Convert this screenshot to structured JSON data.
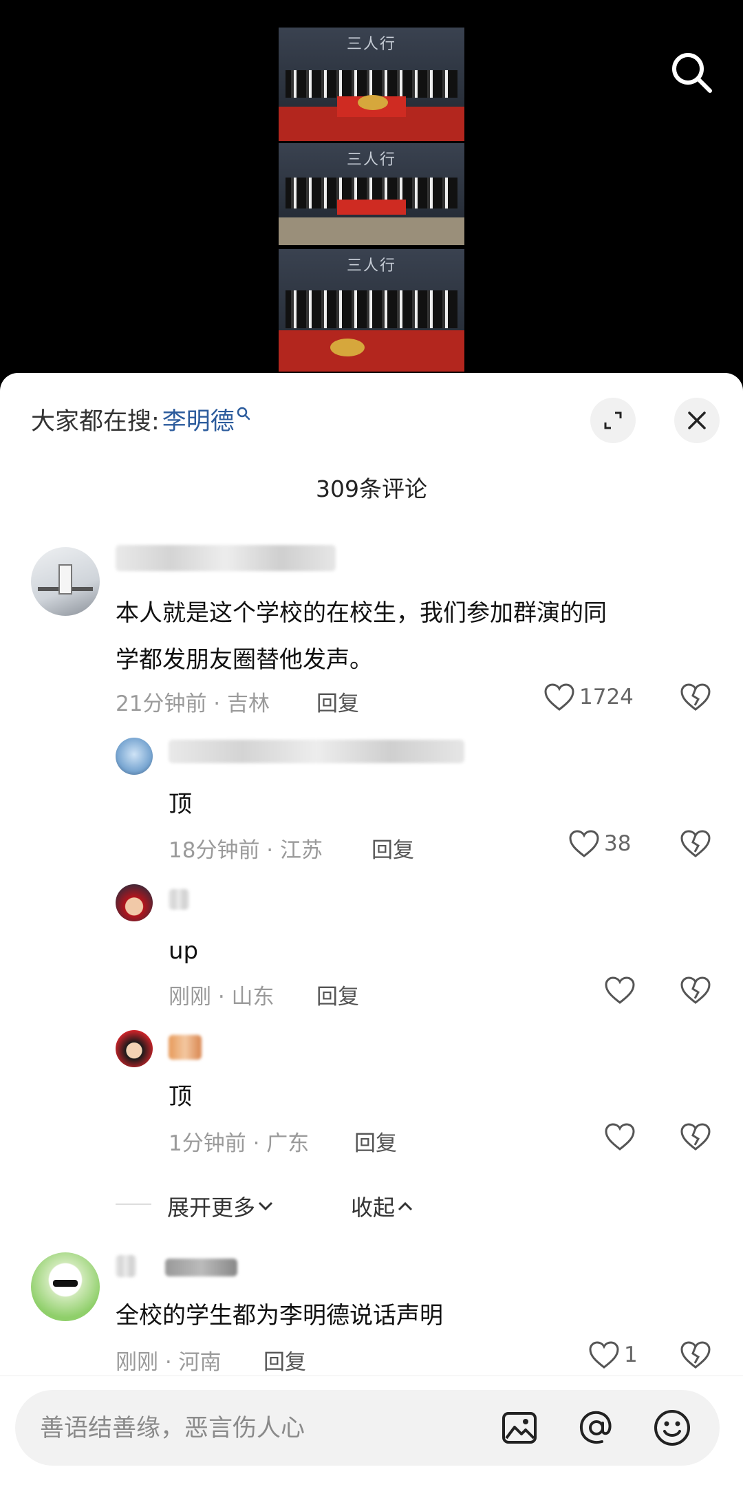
{
  "video": {
    "photo_logo": "三人行"
  },
  "search_bar": {
    "prefix": "大家都在搜:",
    "keyword": "李明德"
  },
  "comment_count": "309条评论",
  "comments": [
    {
      "text_line1": "本人就是这个学校的在校生，我们参加群演的同",
      "text_line2": "学都发朋友圈替他发声。",
      "meta": "21分钟前 · 吉林",
      "reply": "回复",
      "likes": "1724"
    },
    {
      "text_line1": "全校的学生都为李明德说话声明",
      "meta": "刚刚 · 河南",
      "reply": "回复",
      "likes": "1"
    }
  ],
  "replies": [
    {
      "text": "顶",
      "meta": "18分钟前 · 江苏",
      "reply": "回复",
      "likes": "38"
    },
    {
      "text": "up",
      "meta": "刚刚 · 山东",
      "reply": "回复",
      "likes": ""
    },
    {
      "text": "顶",
      "meta": "1分钟前 · 广东",
      "reply": "回复",
      "likes": ""
    }
  ],
  "expand": {
    "more_label": "展开更多",
    "collapse_label": "收起"
  },
  "input": {
    "placeholder": "善语结善缘，恶言伤人心"
  },
  "colors": {
    "keyword": "#2b5b9c",
    "sheet_bg": "#ffffff",
    "input_bg": "#f2f2f2"
  }
}
